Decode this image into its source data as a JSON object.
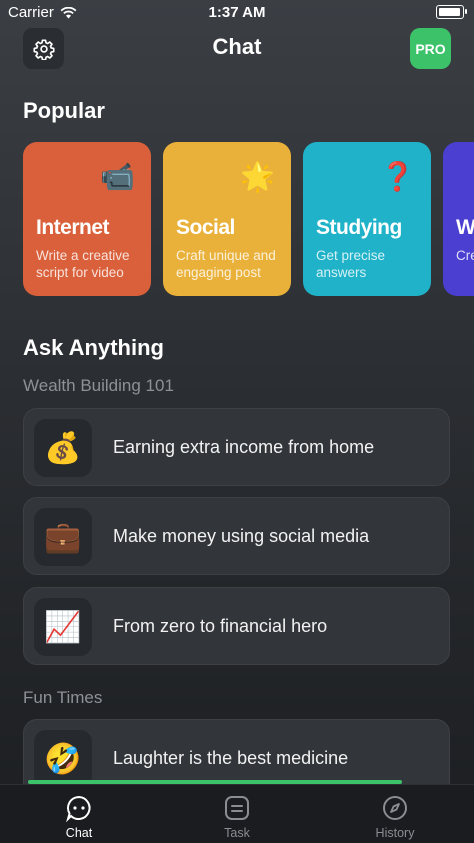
{
  "status_bar": {
    "carrier": "Carrier",
    "time": "1:37 AM",
    "battery_level": 1.0
  },
  "header": {
    "title": "Chat",
    "pro_label": "PRO"
  },
  "popular": {
    "title": "Popular",
    "cards": [
      {
        "title": "Internet",
        "description": "Write a creative script for video",
        "emoji": "📹",
        "color": "#d9603a"
      },
      {
        "title": "Social",
        "description": "Craft unique and engaging post",
        "emoji": "🌟",
        "color": "#e9b13a"
      },
      {
        "title": "Studying",
        "description": "Get precise answers",
        "emoji": "❓",
        "color": "#1fb2c8"
      },
      {
        "title": "Writing",
        "description": "Create and finish",
        "emoji": "✍️",
        "color": "#4a3fd1"
      }
    ]
  },
  "ask_anything": {
    "title": "Ask Anything",
    "groups": [
      {
        "title": "Wealth Building 101",
        "items": [
          {
            "emoji": "💰",
            "text": "Earning extra income from home"
          },
          {
            "emoji": "💼",
            "text": "Make money using social media"
          },
          {
            "emoji": "📈",
            "text": "From zero to financial hero"
          }
        ]
      },
      {
        "title": "Fun Times",
        "items": [
          {
            "emoji": "🤣",
            "text": "Laughter is the best medicine"
          }
        ]
      }
    ]
  },
  "tabs": [
    {
      "label": "Chat",
      "icon": "chat-bubble-icon",
      "active": true
    },
    {
      "label": "Task",
      "icon": "task-list-icon",
      "active": false
    },
    {
      "label": "History",
      "icon": "compass-icon",
      "active": false
    }
  ],
  "colors": {
    "accent_green": "#3cc36a",
    "tab_active": "#ffffff",
    "tab_inactive": "#8a8d92"
  }
}
